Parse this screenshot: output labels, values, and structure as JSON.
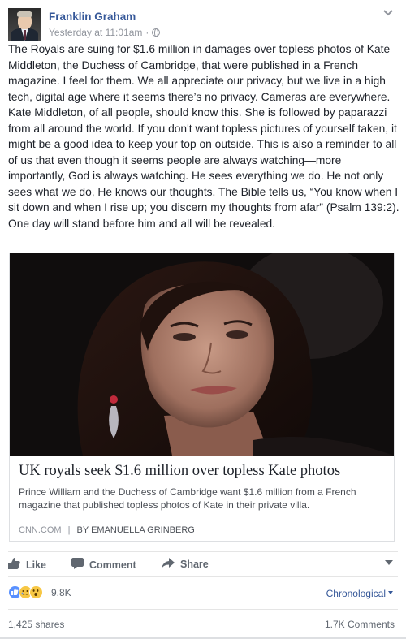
{
  "post": {
    "author": "Franklin Graham",
    "timestamp": "Yesterday at 11:01am",
    "privacy_icon": "globe-icon",
    "body": "The Royals are suing for $1.6 million in damages over topless photos of Kate Middleton, the Duchess of Cambridge, that were published in a French magazine. I feel for them. We all appreciate our privacy, but we live in a high tech, digital age where it seems there’s no privacy. Cameras are everywhere. Kate Middleton, of all people, should know this. She is followed by paparazzi from all around the world. If you don't want topless pictures of yourself taken, it might be a good idea to keep your top on outside. This is also a reminder to all of us that even though it seems people are always watching—more importantly, God is always watching. He sees everything we do. He not only sees what we do, He knows our thoughts. The Bible tells us, “You know when I sit down and when I rise up; you discern my thoughts from afar” (Psalm 139:2). One day will stand before him and all will be revealed."
  },
  "link_card": {
    "title": "UK royals seek $1.6 million over topless Kate photos",
    "description": "Prince William and the Duchess of Cambridge want $1.6 million from a French magazine that published topless photos of Kate in their private villa.",
    "source": "CNN.COM",
    "separator": "|",
    "byline": "BY EMANUELLA GRINBERG"
  },
  "actions": {
    "like_label": "Like",
    "comment_label": "Comment",
    "share_label": "Share"
  },
  "reactions": {
    "icons": [
      "like-reaction-icon",
      "sad-reaction-icon",
      "wow-reaction-icon"
    ],
    "count": "9.8K",
    "sort_label": "Chronological"
  },
  "stats": {
    "shares": "1,425 shares",
    "comments": "1.7K Comments"
  },
  "colors": {
    "link_blue": "#365899",
    "like_blue": "#5890ff",
    "reaction_yellow": "#f7c744",
    "muted_text": "#90949c"
  }
}
